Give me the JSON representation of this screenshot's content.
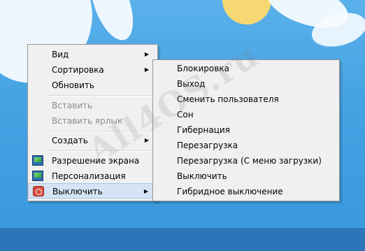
{
  "watermark": "All4OS.ru",
  "context_menu": {
    "items": [
      {
        "label": "Вид",
        "submenu": true,
        "disabled": false
      },
      {
        "label": "Сортировка",
        "submenu": true,
        "disabled": false
      },
      {
        "label": "Обновить",
        "submenu": false,
        "disabled": false
      },
      {
        "label": "Вставить",
        "submenu": false,
        "disabled": true
      },
      {
        "label": "Вставить ярлык",
        "submenu": false,
        "disabled": true
      },
      {
        "label": "Создать",
        "submenu": true,
        "disabled": false
      },
      {
        "label": "Разрешение экрана",
        "submenu": false,
        "disabled": false,
        "icon": "display-resolution-icon"
      },
      {
        "label": "Персонализация",
        "submenu": false,
        "disabled": false,
        "icon": "personalization-icon"
      },
      {
        "label": "Выключить",
        "submenu": true,
        "disabled": false,
        "icon": "power-icon",
        "highlighted": true
      }
    ]
  },
  "shutdown_submenu": {
    "items": [
      {
        "label": "Блокировка"
      },
      {
        "label": "Выход"
      },
      {
        "label": "Сменить пользователя"
      },
      {
        "label": "Сон"
      },
      {
        "label": "Гибернация"
      },
      {
        "label": "Перезагрузка"
      },
      {
        "label": "Перезагрузка (С меню загрузки)"
      },
      {
        "label": "Выключить"
      },
      {
        "label": "Гибридное выключение"
      }
    ]
  },
  "colors": {
    "desktop": "#45a3e3",
    "taskbar": "#2a76b8",
    "menu_bg": "#f0f0f0",
    "hover": "#d4e4f4"
  }
}
